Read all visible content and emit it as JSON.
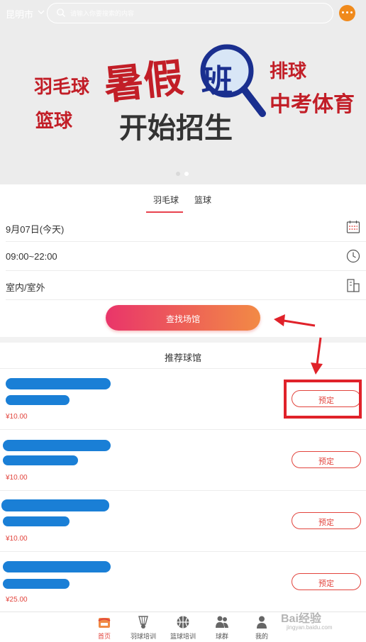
{
  "header": {
    "city": "昆明市",
    "search_placeholder": "请输入你要搜索的内容"
  },
  "banner": {
    "words": [
      "羽毛球",
      "篮球",
      "暑假",
      "班",
      "开始招生",
      "排球",
      "中考体育"
    ],
    "page_count": 2,
    "active_page": 2
  },
  "sport_tabs": [
    {
      "label": "羽毛球",
      "active": true
    },
    {
      "label": "篮球",
      "active": false
    }
  ],
  "filters": {
    "date": "9月07日(今天)",
    "time": "09:00~22:00",
    "location": "室内/室外"
  },
  "find_button": "查找场馆",
  "recommend": {
    "title": "推荐球馆",
    "venues": [
      {
        "price": "¥10.00",
        "book": "预定"
      },
      {
        "price": "¥10.00",
        "book": "预定"
      },
      {
        "price": "¥10.00",
        "book": "预定"
      },
      {
        "price": "¥25.00",
        "book": "预定"
      }
    ]
  },
  "nav": [
    {
      "label": "首页",
      "icon": "home-icon",
      "active": true
    },
    {
      "label": "羽球培训",
      "icon": "shuttlecock-icon",
      "active": false
    },
    {
      "label": "篮球培训",
      "icon": "basketball-icon",
      "active": false
    },
    {
      "label": "球群",
      "icon": "group-icon",
      "active": false
    },
    {
      "label": "我的",
      "icon": "person-icon",
      "active": false
    }
  ],
  "watermark": {
    "brand": "Bai经验",
    "url": "jingyan.baidu.com"
  },
  "colors": {
    "accent": "#e2443d",
    "gradient_start": "#e9356a",
    "gradient_end": "#f28a45",
    "annotation": "#e0222a",
    "redaction": "#1a7fd6"
  }
}
